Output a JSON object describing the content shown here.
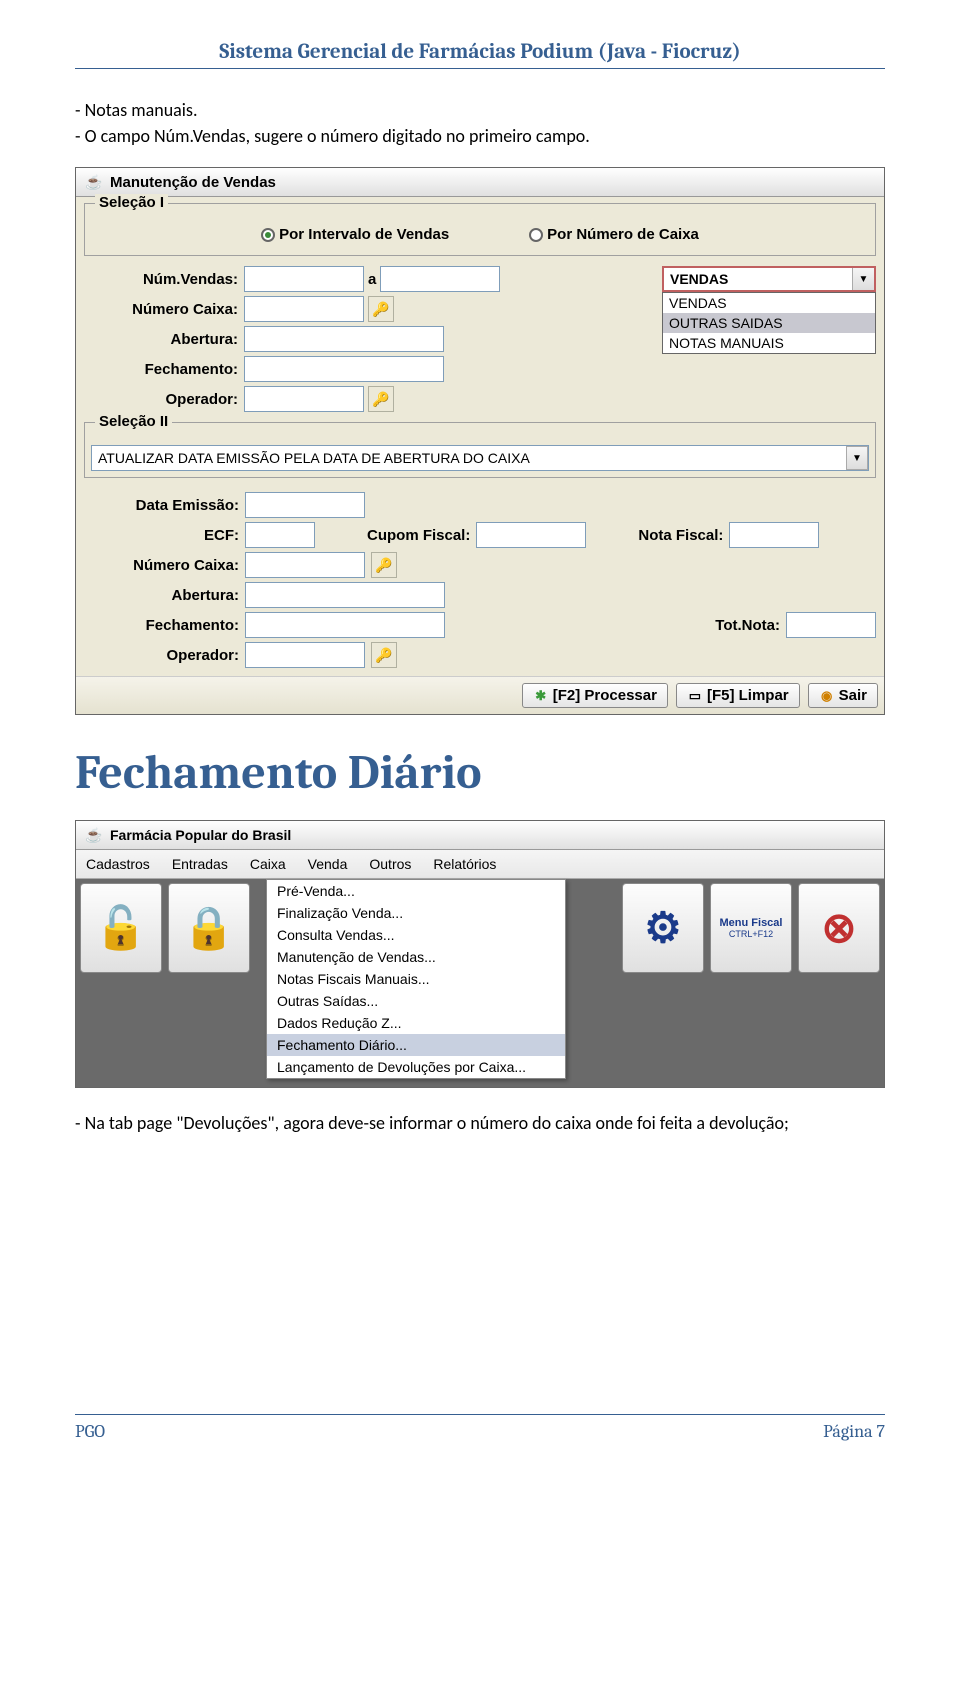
{
  "header": {
    "title": "Sistema Gerencial de Farmácias Podium (Java - Fiocruz)"
  },
  "intro": {
    "line1": "- Notas manuais.",
    "line2": "- O campo Núm.Vendas, sugere o número digitado no primeiro campo."
  },
  "shot1": {
    "title": "Manutenção de Vendas",
    "selecao1": {
      "legend": "Seleção I",
      "r1": "Por Intervalo de Vendas",
      "r2": "Por Número de Caixa"
    },
    "labels": {
      "numvendas": "Núm.Vendas:",
      "a": "a",
      "numcaixa": "Número Caixa:",
      "abertura": "Abertura:",
      "fechamento": "Fechamento:",
      "operador": "Operador:"
    },
    "combo": {
      "value": "VENDAS",
      "opts": [
        "VENDAS",
        "OUTRAS SAIDAS",
        "NOTAS MANUAIS"
      ],
      "selected_index": 1
    },
    "selecao2": {
      "legend": "Seleção II",
      "value": "ATUALIZAR DATA EMISSÃO PELA DATA DE ABERTURA DO CAIXA"
    },
    "labels2": {
      "dataemissao": "Data Emissão:",
      "ecf": "ECF:",
      "cupom": "Cupom Fiscal:",
      "nota": "Nota Fiscal:",
      "numcaixa": "Número Caixa:",
      "abertura": "Abertura:",
      "fechamento": "Fechamento:",
      "totnota": "Tot.Nota:",
      "operador": "Operador:"
    },
    "buttons": {
      "processar": "[F2] Processar",
      "limpar": "[F5] Limpar",
      "sair": "Sair"
    }
  },
  "section_title": "Fechamento Diário",
  "shot2": {
    "title": "Farmácia Popular do Brasil",
    "menus": [
      "Cadastros",
      "Entradas",
      "Caixa",
      "Venda",
      "Outros",
      "Relatórios"
    ],
    "dropdown": [
      "Pré-Venda...",
      "Finalização Venda...",
      "Consulta Vendas...",
      "Manutenção de Vendas...",
      "Notas Fiscais Manuais...",
      "Outras Saídas...",
      "Dados Redução Z...",
      "Fechamento Diário...",
      "Lançamento de Devoluções por Caixa..."
    ],
    "highlighted": "Fechamento Diário...",
    "btn_menu_fiscal": "Menu Fiscal",
    "btn_menu_fiscal_sub": "CTRL+F12"
  },
  "outro": "- Na tab page \"Devoluções\", agora deve-se informar o número do caixa onde foi feita a devolução;",
  "footer": {
    "left": "PGO",
    "right": "Página 7"
  }
}
